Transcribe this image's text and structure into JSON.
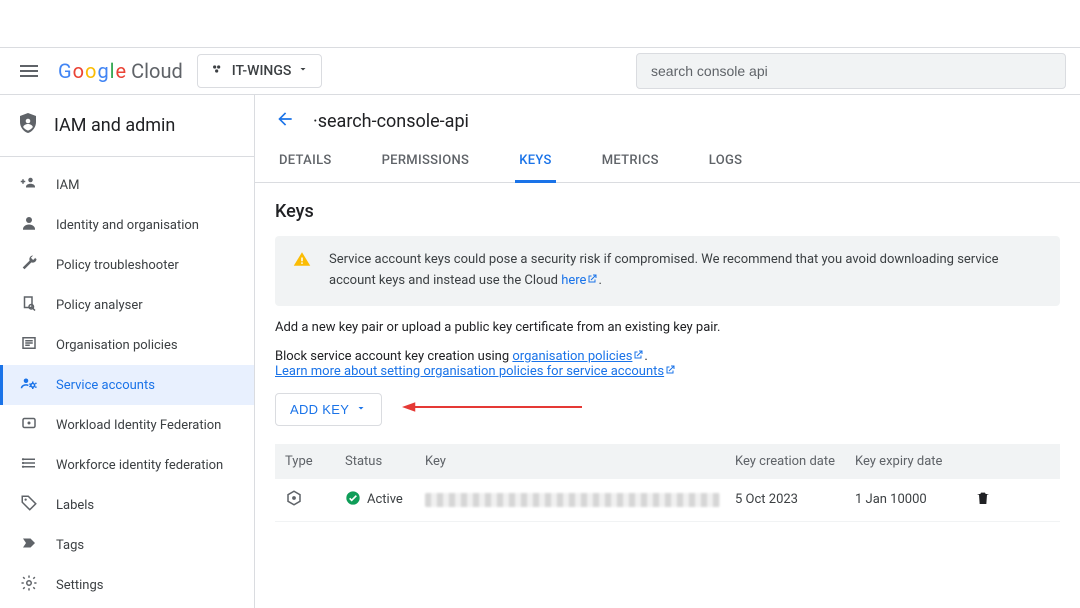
{
  "header": {
    "project_name": "IT-WINGS",
    "search_value": "search console api"
  },
  "sidebar": {
    "title": "IAM and admin",
    "items": [
      {
        "label": "IAM"
      },
      {
        "label": "Identity and organisation"
      },
      {
        "label": "Policy troubleshooter"
      },
      {
        "label": "Policy analyser"
      },
      {
        "label": "Organisation policies"
      },
      {
        "label": "Service accounts"
      },
      {
        "label": "Workload Identity Federation"
      },
      {
        "label": "Workforce identity federation"
      },
      {
        "label": "Labels"
      },
      {
        "label": "Tags"
      },
      {
        "label": "Settings"
      }
    ]
  },
  "main": {
    "page_title": "·search-console-api",
    "tabs": [
      "DETAILS",
      "PERMISSIONS",
      "KEYS",
      "METRICS",
      "LOGS"
    ],
    "active_tab": "KEYS",
    "section_heading": "Keys",
    "warning_text": "Service account keys could pose a security risk if compromised. We recommend that you avoid downloading service account keys and instead use the Cloud",
    "warning_link_text": "here",
    "instruction": "Add a new key pair or upload a public key certificate from an existing key pair.",
    "block_text_prefix": "Block service account key creation using ",
    "block_link_text": "organisation policies",
    "learn_more_text": "Learn more about setting organisation policies for service accounts",
    "add_key_label": "ADD KEY",
    "table": {
      "headers": [
        "Type",
        "Status",
        "Key",
        "Key creation date",
        "Key expiry date",
        ""
      ],
      "rows": [
        {
          "status": "Active",
          "creation": "5 Oct 2023",
          "expiry": "1 Jan 10000"
        }
      ]
    }
  }
}
